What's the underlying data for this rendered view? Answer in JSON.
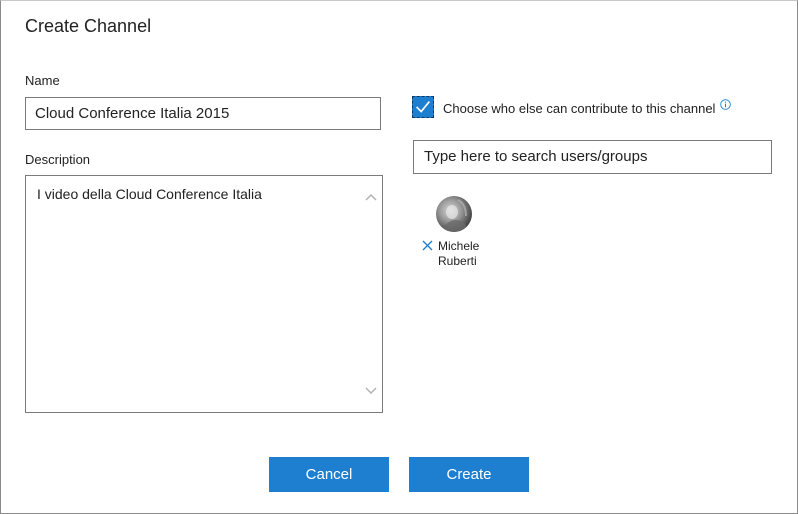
{
  "dialog": {
    "title": "Create Channel"
  },
  "form": {
    "name_label": "Name",
    "name_value": "Cloud Conference Italia 2015",
    "description_label": "Description",
    "description_value": "I video della Cloud Conference Italia",
    "contributors_checkbox_label": "Choose who else can contribute to this channel",
    "contributors_checkbox_checked": true,
    "search_placeholder": "Type here to search users/groups"
  },
  "contributors": [
    {
      "first_name": "Michele",
      "last_name": "Ruberti"
    }
  ],
  "buttons": {
    "cancel_label": "Cancel",
    "create_label": "Create"
  },
  "colors": {
    "accent": "#1e7fd0",
    "border": "#7a7a7a",
    "remove_icon": "#1e7fd0"
  },
  "icons": {
    "info": "info-icon",
    "check": "checkmark-icon",
    "remove": "close-icon",
    "scroll_up": "chevron-up-icon",
    "scroll_down": "chevron-down-icon"
  }
}
